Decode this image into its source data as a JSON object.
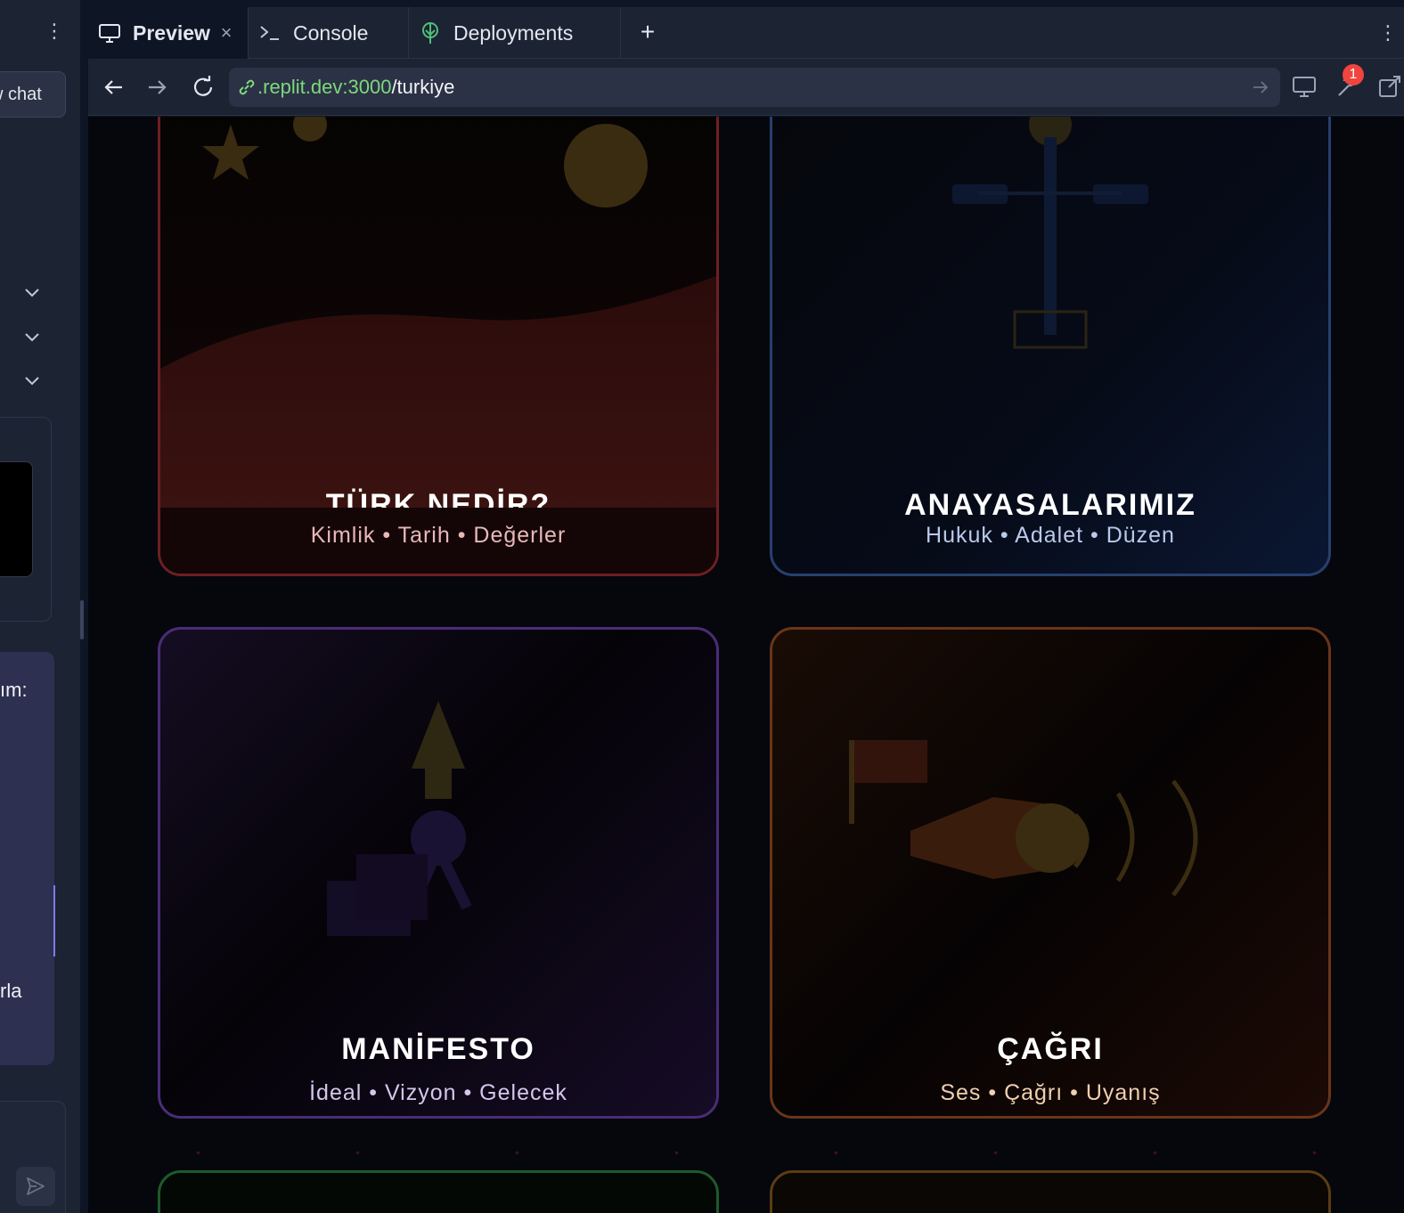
{
  "sidebar": {
    "new_chat_label": "w chat",
    "message_text_1": "ım:",
    "message_text_2": "rla"
  },
  "tabs": {
    "preview": "Preview",
    "console": "Console",
    "deployments": "Deployments",
    "close_symbol": "×",
    "add_symbol": "+"
  },
  "urlbar": {
    "host": ".replit.dev:3000",
    "path": "/turkiye",
    "notification_count": "1"
  },
  "cards": [
    {
      "title": "TÜRK NEDİR?",
      "subtitle": "Kimlik • Tarih • Değerler",
      "subtitle_color": "#e8b8b8"
    },
    {
      "title": "ANAYASALARIMIZ",
      "subtitle": "Hukuk • Adalet • Düzen",
      "subtitle_color": "#b9c9ea"
    },
    {
      "title": "MANİFESTO",
      "subtitle": "İdeal • Vizyon • Gelecek",
      "subtitle_color": "#d4c6ec"
    },
    {
      "title": "ÇAĞRI",
      "subtitle": "Ses • Çağrı • Uyanış",
      "subtitle_color": "#f0cfae"
    }
  ],
  "colors": {
    "accent_green": "#7dd87d",
    "badge_red": "#f0443e",
    "card_border_red": "#6e1f22",
    "card_border_blue": "#27406e",
    "card_border_purple": "#4b2c78",
    "card_border_orange": "#6a3519",
    "card_border_green": "#1d5a2c",
    "card_border_gold": "#5b3d14"
  }
}
